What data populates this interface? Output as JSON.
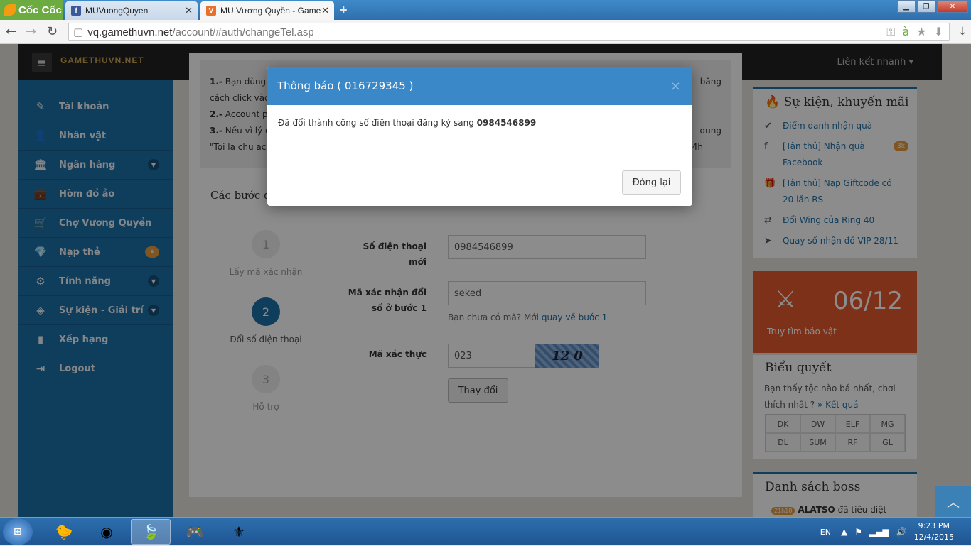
{
  "browser": {
    "logo": "Cốc Cốc",
    "tabs": [
      {
        "title": "MUVuongQuyen",
        "close": "✕"
      },
      {
        "title": "MU Vương Quyền - Game",
        "close": "✕"
      }
    ],
    "new_tab": "+",
    "url_host": "vq.gamethuvn.net",
    "url_path": "/account/#auth/changeTel.asp",
    "window_buttons": [
      "▁",
      "❐",
      "✕"
    ]
  },
  "header": {
    "brand": "GAMETHUVN.NET",
    "quick_link": "Liên kết nhanh ▾"
  },
  "sidebar": {
    "items": [
      {
        "label": "Tài khoản",
        "icon": "✎",
        "suffix": ""
      },
      {
        "label": "Nhân vật",
        "icon": "👤",
        "suffix": ""
      },
      {
        "label": "Ngân hàng",
        "icon": "🏛",
        "suffix": "chevron"
      },
      {
        "label": "Hòm đồ ảo",
        "icon": "💼",
        "suffix": ""
      },
      {
        "label": "Chợ Vương Quyền",
        "icon": "🛒",
        "suffix": ""
      },
      {
        "label": "Nạp thẻ",
        "icon": "💎",
        "suffix": "star"
      },
      {
        "label": "Tính năng",
        "icon": "⚙",
        "suffix": "chevron"
      },
      {
        "label": "Sự kiện - Giải trí",
        "icon": "◈",
        "suffix": "chevron"
      },
      {
        "label": "Xếp hạng",
        "icon": "▮",
        "suffix": ""
      },
      {
        "label": "Logout",
        "icon": "⇥",
        "suffix": ""
      }
    ]
  },
  "notice": {
    "line1_num": "1.-",
    "line1": "Bạn dùng",
    "line1_end": "bằng",
    "line1b": "cách click vào",
    "line2_num": "2.-",
    "line2": "Account pł",
    "line3_num": "3.-",
    "line3": "Nếu vì lý d",
    "line3_end": "dung",
    "line3b": "\"Toi la chu acc",
    "line3b_end": "4h"
  },
  "steps": {
    "title": "Các bước đổi số đăng ký",
    "items": [
      {
        "num": "1",
        "label": "Lấy mã xác nhận"
      },
      {
        "num": "2",
        "label": "Đổi số điện thoại"
      },
      {
        "num": "3",
        "label": "Hỗ trợ"
      }
    ]
  },
  "form": {
    "phone_label_1": "Số điện thoại",
    "phone_label_2": "mới",
    "phone_value": "0984546899",
    "code_label_1": "Mã xác nhận đổi",
    "code_label_2": "số ở bước 1",
    "code_value": "seked",
    "hint": "Bạn chưa có mã? Mới",
    "hint_link": "quay về bước 1",
    "captcha_label": "Mã xác thực",
    "captcha_value": "023",
    "captcha_image_text": "12 0",
    "submit": "Thay đổi"
  },
  "events": {
    "title": "Sự kiện, khuyến mãi",
    "items": [
      {
        "icon": "✔",
        "text": "Điểm danh nhận quà",
        "badge": ""
      },
      {
        "icon": "f",
        "text": "[Tân thủ] Nhận quà Facebook",
        "badge": "3k"
      },
      {
        "icon": "🎁",
        "text": "[Tân thủ] Nạp Giftcode có 20 lần RS",
        "badge": ""
      },
      {
        "icon": "⇄",
        "text": "Đổi Wing của Ring 40",
        "badge": ""
      },
      {
        "icon": "➤",
        "text": "Quay số nhận đồ VIP 28/11",
        "badge": ""
      }
    ]
  },
  "treasure": {
    "date": "06/12",
    "label": "Truy tìm bảo vật"
  },
  "vote": {
    "title": "Biểu quyết",
    "question": "Bạn thấy tộc nào bá nhất, chơi thích nhất ?",
    "result_link": "» Kết quả",
    "options": [
      "DK",
      "DW",
      "ELF",
      "MG",
      "DL",
      "SUM",
      "RF",
      "GL"
    ]
  },
  "boss": {
    "title": "Danh sách boss",
    "time": "21h18",
    "name": "ALATSO",
    "text": "đã tiêu diệt"
  },
  "modal": {
    "title": "Thông báo ( 016729345 )",
    "close_x": "×",
    "message": "Đã đổi thành công số điện thoại đăng ký sang",
    "phone": "0984546899",
    "close_button": "Đóng lại"
  },
  "taskbar": {
    "lang": "EN",
    "time": "9:23 PM",
    "date": "12/4/2015"
  },
  "colors": {
    "sidebar": "#1d6fa8",
    "modal_header": "#3b88c8",
    "treasure": "#e45a2d",
    "badge": "#e89b3c"
  }
}
